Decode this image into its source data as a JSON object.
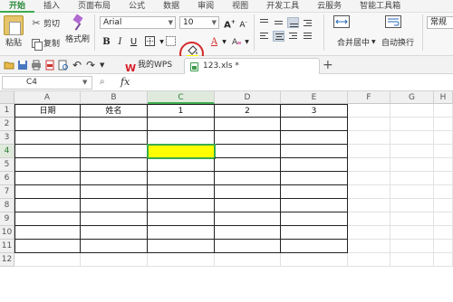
{
  "ribbon_tabs": [
    "开始",
    "插入",
    "页面布局",
    "公式",
    "数据",
    "审阅",
    "视图",
    "开发工具",
    "云服务",
    "智能工具箱"
  ],
  "active_tab": "开始",
  "clipboard": {
    "paste": "粘贴",
    "cut": "剪切",
    "copy": "复制",
    "format_painter": "格式刷"
  },
  "font": {
    "name": "Arial",
    "size": "10"
  },
  "font_buttons": {
    "bold": "B",
    "italic": "I",
    "underline": "U",
    "font_color": "A"
  },
  "merge_center": "合并居中",
  "wrap_text": "自动换行",
  "number_format": "常规",
  "doc_tabs": [
    {
      "label": "我的WPS"
    },
    {
      "label": "123.xls *"
    }
  ],
  "formula_bar": {
    "name_box": "C4",
    "fx": "fx",
    "formula": ""
  },
  "columns": [
    "A",
    "B",
    "C",
    "D",
    "E",
    "F",
    "G",
    "H"
  ],
  "rows": [
    "1",
    "2",
    "3",
    "4",
    "5",
    "6",
    "7",
    "8",
    "9",
    "10",
    "11",
    "12"
  ],
  "header_row": {
    "A": "日期",
    "B": "姓名",
    "C": "1",
    "D": "2",
    "E": "3"
  },
  "selected_cell": "C4",
  "colors": {
    "accent": "#3cab4d",
    "fill_yellow": "#ffff00",
    "annotation_red": "#d42a2a"
  }
}
